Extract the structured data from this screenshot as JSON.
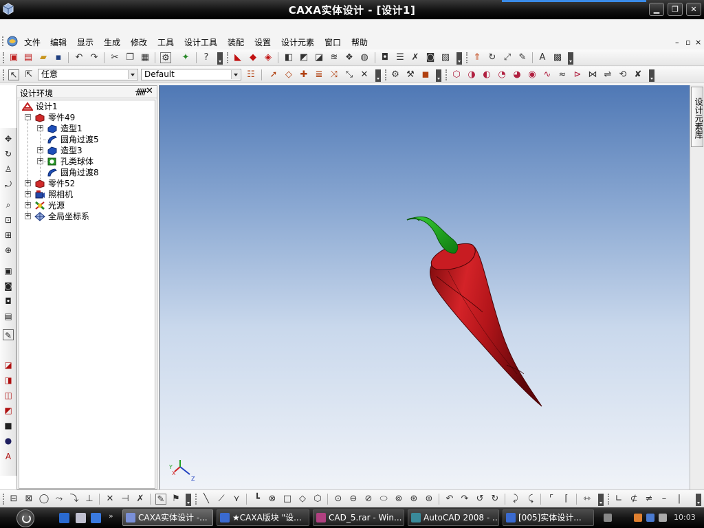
{
  "window": {
    "title": "CAXA实体设计 - [设计1]",
    "minimize_glyph": "▁",
    "maximize_glyph": "❐",
    "close_glyph": "✕"
  },
  "menubar": {
    "items": [
      "文件",
      "编辑",
      "显示",
      "生成",
      "修改",
      "工具",
      "设计工具",
      "装配",
      "设置",
      "设计元素",
      "窗口",
      "帮助"
    ],
    "mdi_controls": [
      "–",
      "▫",
      "×"
    ]
  },
  "toolbar3": {
    "selection_filter": "任意",
    "config": "Default"
  },
  "design_panel": {
    "title": "设计环境",
    "pin_glyph": "ᚏ",
    "close_glyph": "✕",
    "tree": [
      {
        "label": "设计1",
        "icon": "design-icon"
      },
      {
        "label": "零件49",
        "icon": "part-icon",
        "expanded": true
      },
      {
        "label": "造型1",
        "icon": "shape-icon"
      },
      {
        "label": "圆角过渡5",
        "icon": "fillet-icon"
      },
      {
        "label": "造型3",
        "icon": "shape-icon"
      },
      {
        "label": "孔类球体",
        "icon": "hole-icon"
      },
      {
        "label": "圆角过渡8",
        "icon": "fillet-icon"
      },
      {
        "label": "零件52",
        "icon": "part-icon"
      },
      {
        "label": "照相机",
        "icon": "camera-icon"
      },
      {
        "label": "光源",
        "icon": "light-icon"
      },
      {
        "label": "全局坐标系",
        "icon": "coordinate-system-icon"
      }
    ]
  },
  "viewport": {
    "triad": {
      "x": "X",
      "y": "Y",
      "z": "Z"
    },
    "colors": {
      "sky_top": "#4f78b5",
      "sky_bottom": "#f0f3f8",
      "body": "#c0171d",
      "stem": "#1aa21a"
    }
  },
  "right_tab": {
    "label": "设计元素库"
  },
  "taskbar": {
    "tasks": [
      {
        "label": "CAXA实体设计 -...",
        "active": true
      },
      {
        "label": "★CAXA版块 \"设...",
        "active": false
      },
      {
        "label": "CAD_5.rar - Win...",
        "active": false
      },
      {
        "label": "AutoCAD 2008 - ...",
        "active": false
      },
      {
        "label": "[005]实体设计...",
        "active": false
      }
    ],
    "clock": "10:03"
  }
}
